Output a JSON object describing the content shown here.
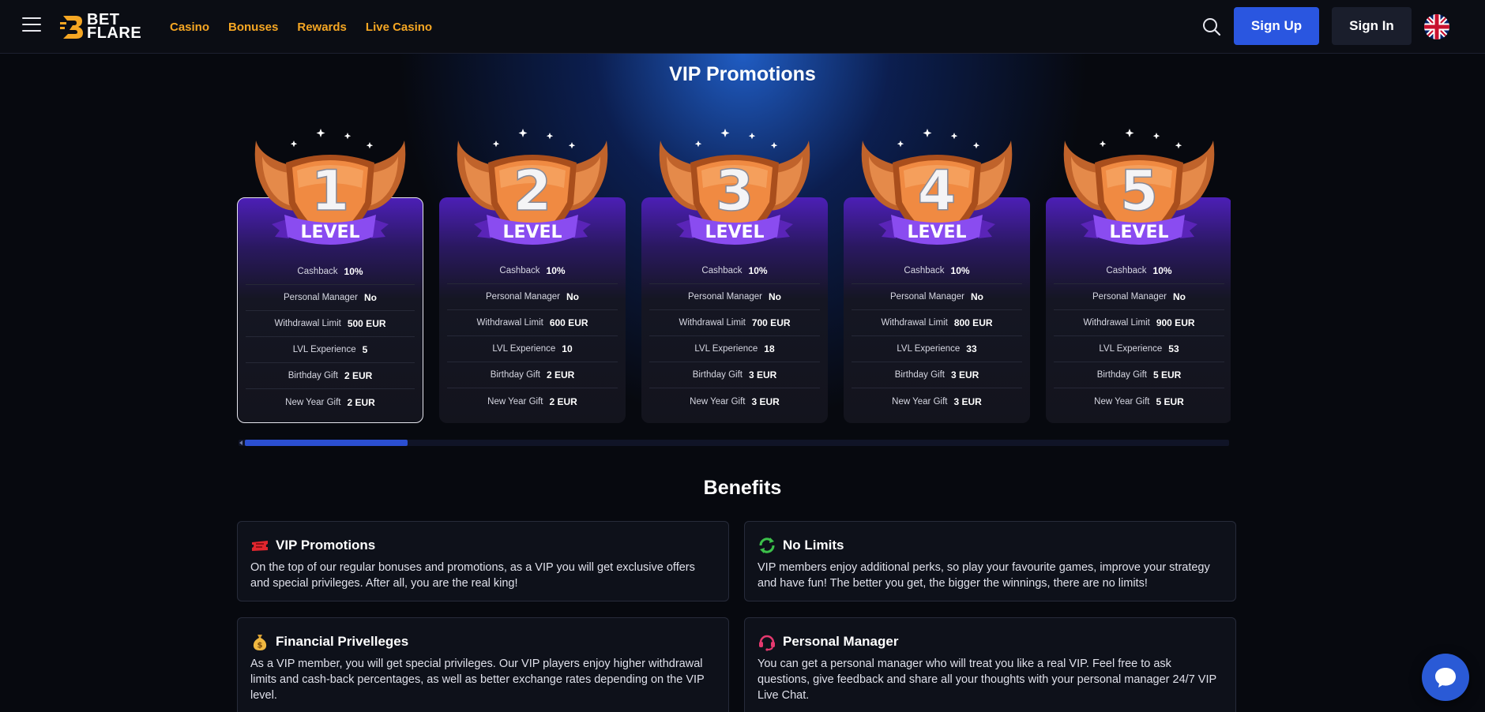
{
  "header": {
    "logo_line1": "BET",
    "logo_line2": "FLARE",
    "nav": [
      "Casino",
      "Bonuses",
      "Rewards",
      "Live Casino"
    ],
    "signup_label": "Sign Up",
    "signin_label": "Sign In",
    "language_flag": "uk-flag-icon"
  },
  "vip": {
    "title": "VIP Promotions",
    "badge_word": "LEVEL",
    "levels": [
      {
        "number": "1",
        "rows": [
          [
            "Cashback",
            "10%"
          ],
          [
            "Personal Manager",
            "No"
          ],
          [
            "Withdrawal Limit",
            "500 EUR"
          ],
          [
            "LVL Experience",
            "5"
          ],
          [
            "Birthday Gift",
            "2 EUR"
          ],
          [
            "New Year Gift",
            "2 EUR"
          ]
        ]
      },
      {
        "number": "2",
        "rows": [
          [
            "Cashback",
            "10%"
          ],
          [
            "Personal Manager",
            "No"
          ],
          [
            "Withdrawal Limit",
            "600 EUR"
          ],
          [
            "LVL Experience",
            "10"
          ],
          [
            "Birthday Gift",
            "2 EUR"
          ],
          [
            "New Year Gift",
            "2 EUR"
          ]
        ]
      },
      {
        "number": "3",
        "rows": [
          [
            "Cashback",
            "10%"
          ],
          [
            "Personal Manager",
            "No"
          ],
          [
            "Withdrawal Limit",
            "700 EUR"
          ],
          [
            "LVL Experience",
            "18"
          ],
          [
            "Birthday Gift",
            "3 EUR"
          ],
          [
            "New Year Gift",
            "3 EUR"
          ]
        ]
      },
      {
        "number": "4",
        "rows": [
          [
            "Cashback",
            "10%"
          ],
          [
            "Personal Manager",
            "No"
          ],
          [
            "Withdrawal Limit",
            "800 EUR"
          ],
          [
            "LVL Experience",
            "33"
          ],
          [
            "Birthday Gift",
            "3 EUR"
          ],
          [
            "New Year Gift",
            "3 EUR"
          ]
        ]
      },
      {
        "number": "5",
        "rows": [
          [
            "Cashback",
            "10%"
          ],
          [
            "Personal Manager",
            "No"
          ],
          [
            "Withdrawal Limit",
            "900 EUR"
          ],
          [
            "LVL Experience",
            "53"
          ],
          [
            "Birthday Gift",
            "5 EUR"
          ],
          [
            "New Year Gift",
            "5 EUR"
          ]
        ]
      }
    ],
    "active_level_index": 0
  },
  "benefits": {
    "title": "Benefits",
    "items": [
      {
        "icon": "ticket-icon",
        "title": "VIP Promotions",
        "text": "On the top of our regular bonuses and promotions, as a VIP you will get exclusive offers and special privileges. After all, you are the real king!"
      },
      {
        "icon": "refresh-arrows-icon",
        "title": "No Limits",
        "text": "VIP members enjoy additional perks, so play your favourite games, improve your strategy and have fun! The better you get, the bigger the winnings, there are no limits!"
      },
      {
        "icon": "money-bag-icon",
        "title": "Financial Privelleges",
        "text": "As a VIP member, you will get special privileges. Our VIP players enjoy higher withdrawal limits and cash-back percentages, as well as better exchange rates depending on the VIP level."
      },
      {
        "icon": "headset-icon",
        "title": "Personal Manager",
        "text": "You can get a personal manager who will treat you like a real VIP. Feel free to ask questions, give feedback and share all your thoughts with your personal manager 24/7 VIP Live Chat."
      }
    ]
  },
  "colors": {
    "accent_nav": "#f5a623",
    "primary_button": "#2a56e0",
    "card_purple": "#4c1fb6",
    "badge_orange": "#e27c3c",
    "ribbon_purple": "#7a3fe0"
  }
}
